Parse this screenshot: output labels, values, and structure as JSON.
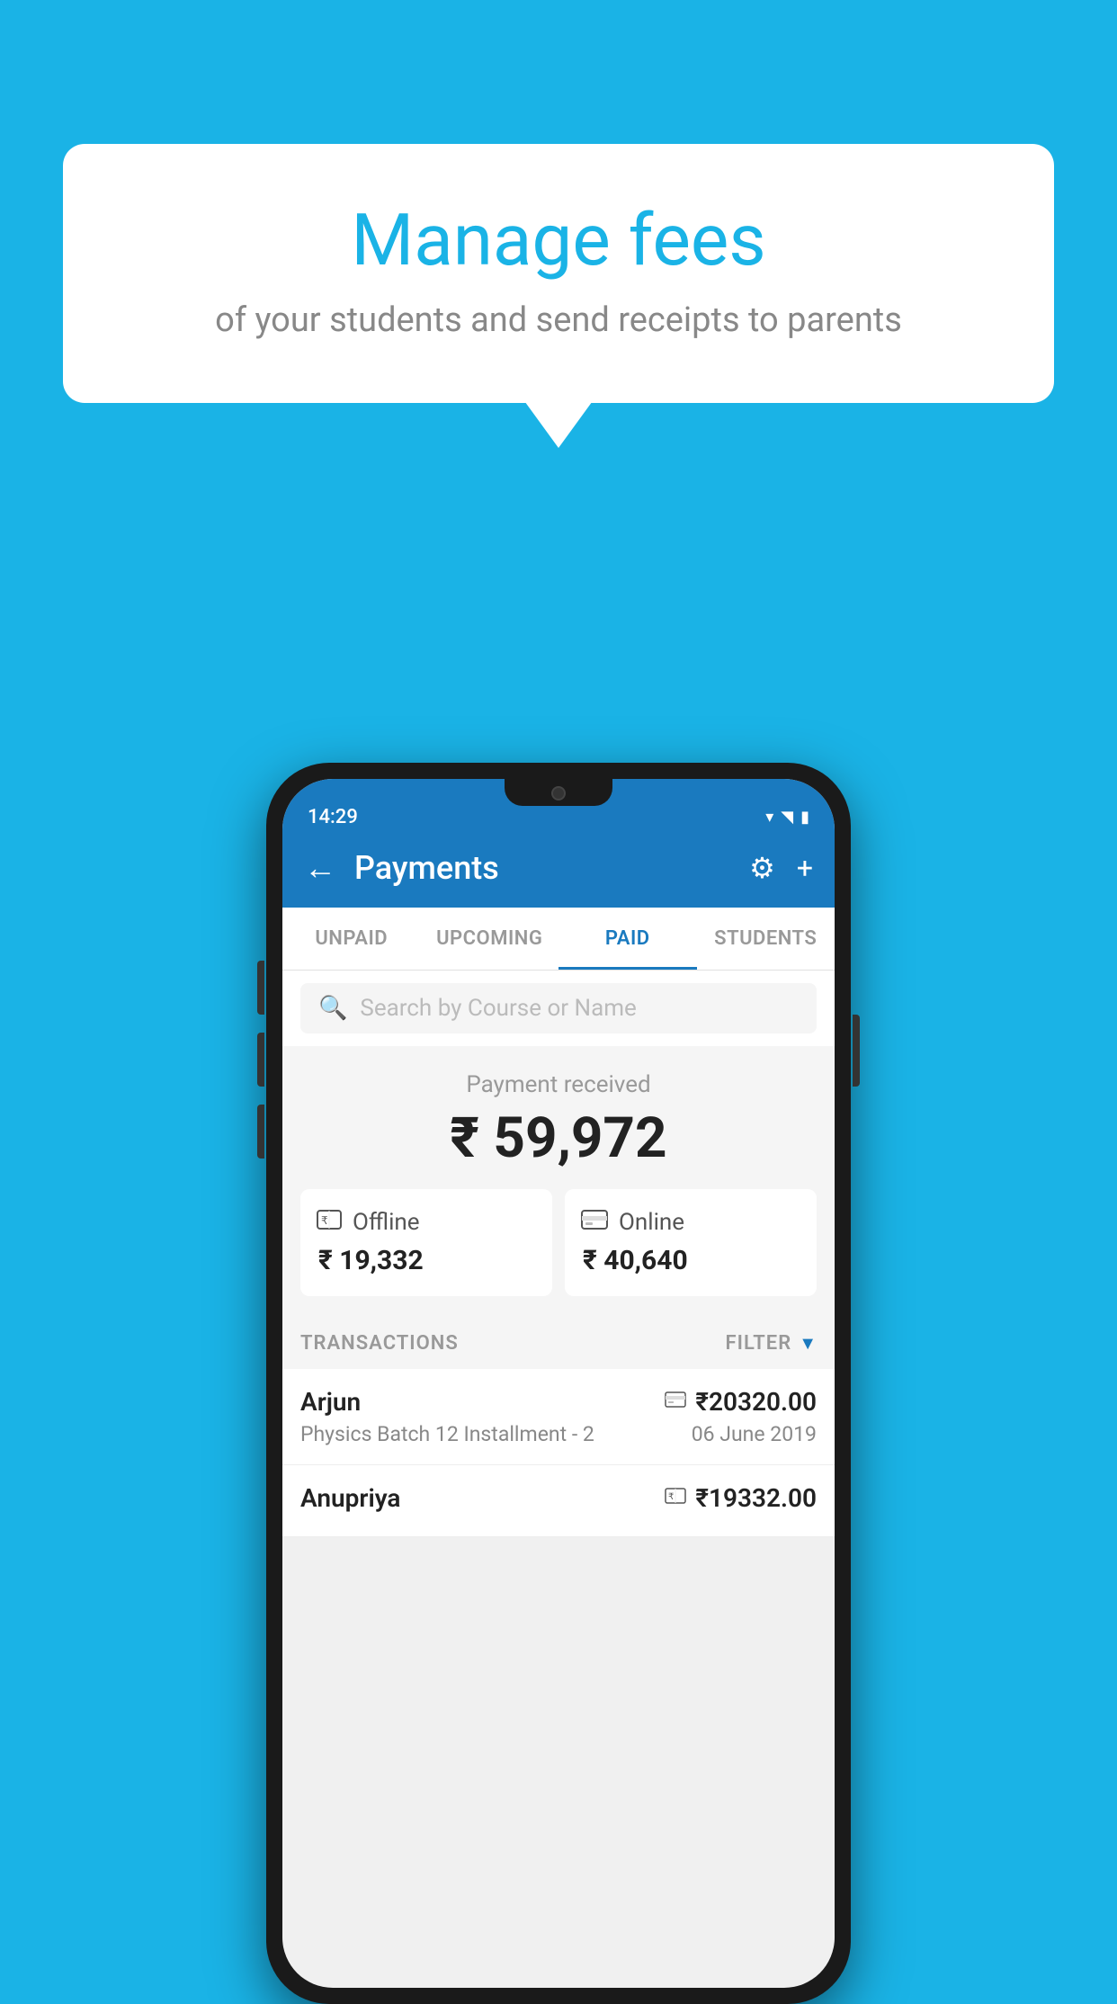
{
  "page": {
    "background_color": "#1ab3e6"
  },
  "speech_bubble": {
    "title": "Manage fees",
    "subtitle": "of your students and send receipts to parents"
  },
  "status_bar": {
    "time": "14:29",
    "wifi_icon": "▾",
    "signal_icon": "▲",
    "battery_icon": "▮"
  },
  "app_bar": {
    "back_label": "←",
    "title": "Payments",
    "gear_icon": "⚙",
    "plus_icon": "+"
  },
  "tabs": [
    {
      "id": "unpaid",
      "label": "UNPAID",
      "active": false
    },
    {
      "id": "upcoming",
      "label": "UPCOMING",
      "active": false
    },
    {
      "id": "paid",
      "label": "PAID",
      "active": true
    },
    {
      "id": "students",
      "label": "STUDENTS",
      "active": false
    }
  ],
  "search": {
    "placeholder": "Search by Course or Name",
    "icon": "🔍"
  },
  "payment_received": {
    "label": "Payment received",
    "total": "₹ 59,972",
    "offline": {
      "icon": "💵",
      "label": "Offline",
      "amount": "₹ 19,332"
    },
    "online": {
      "icon": "💳",
      "label": "Online",
      "amount": "₹ 40,640"
    }
  },
  "transactions_header": {
    "label": "TRANSACTIONS",
    "filter_label": "FILTER",
    "filter_icon": "▼"
  },
  "transactions": [
    {
      "name": "Arjun",
      "course": "Physics Batch 12 Installment - 2",
      "amount": "₹20320.00",
      "date": "06 June 2019",
      "payment_type": "online"
    },
    {
      "name": "Anupriya",
      "course": "",
      "amount": "₹19332.00",
      "date": "",
      "payment_type": "offline"
    }
  ]
}
